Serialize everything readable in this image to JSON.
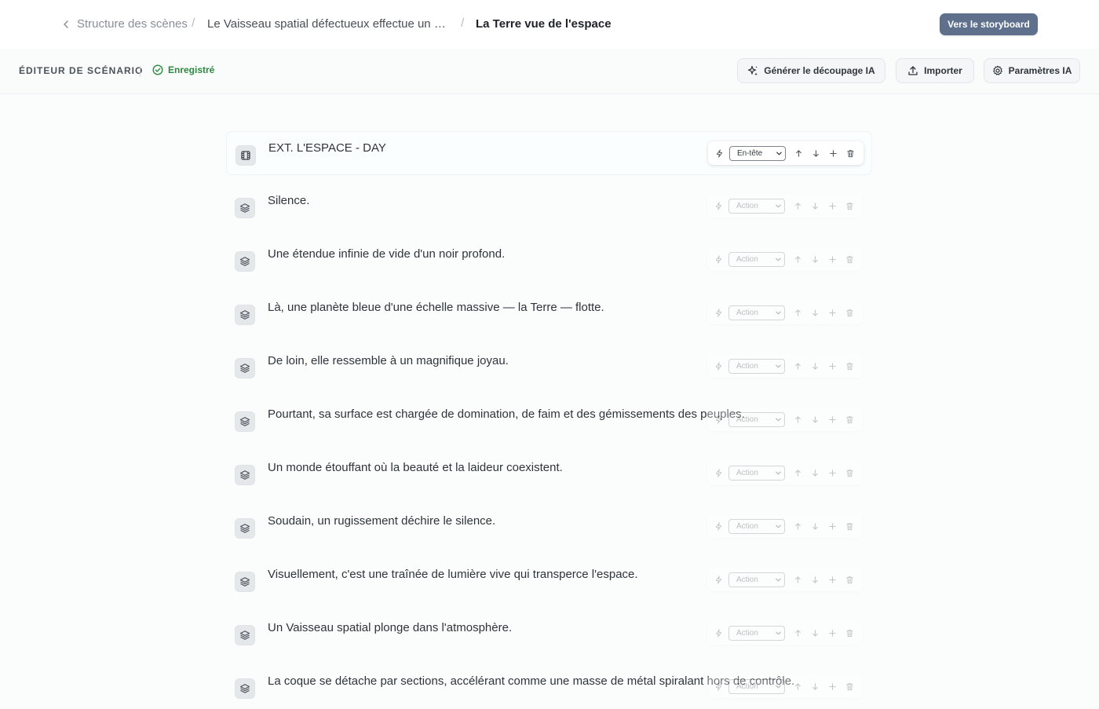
{
  "breadcrumb": {
    "back_label": "Structure des scènes",
    "middle": "Le Vaisseau spatial défectueux effectue un atte…",
    "current": "La Terre vue de l'espace"
  },
  "header": {
    "storyboard_button": "Vers le storyboard"
  },
  "toolbar": {
    "title": "ÉDITEUR DE SCÉNARIO",
    "saved_status": "Enregistré",
    "generate_button": "Générer le découpage IA",
    "import_button": "Importer",
    "settings_button": "Paramètres IA"
  },
  "colors": {
    "accent": "#5e708c",
    "saved": "#2b8a3e"
  },
  "lines": [
    {
      "icon": "film-icon",
      "text": "EXT. L'ESPACE - DAY",
      "type": "En-tête",
      "active": true
    },
    {
      "icon": "layers-icon",
      "text": "Silence.",
      "type": "Action",
      "active": false
    },
    {
      "icon": "layers-icon",
      "text": "Une étendue infinie de vide d'un noir profond.",
      "type": "Action",
      "active": false
    },
    {
      "icon": "layers-icon",
      "text": "Là, une planète bleue d'une échelle massive — la Terre — flotte.",
      "type": "Action",
      "active": false
    },
    {
      "icon": "layers-icon",
      "text": "De loin, elle ressemble à un magnifique joyau.",
      "type": "Action",
      "active": false
    },
    {
      "icon": "layers-icon",
      "text": "Pourtant, sa surface est chargée de domination, de faim et des gémissements des peuples.",
      "type": "Action",
      "active": false
    },
    {
      "icon": "layers-icon",
      "text": "Un monde étouffant où la beauté et la laideur coexistent.",
      "type": "Action",
      "active": false
    },
    {
      "icon": "layers-icon",
      "text": "Soudain, un rugissement déchire le silence.",
      "type": "Action",
      "active": false
    },
    {
      "icon": "layers-icon",
      "text": "Visuellement, c'est une traînée de lumière vive qui transperce l'espace.",
      "type": "Action",
      "active": false
    },
    {
      "icon": "layers-icon",
      "text": "Un Vaisseau spatial plonge dans l'atmosphère.",
      "type": "Action",
      "active": false
    },
    {
      "icon": "layers-icon",
      "text": "La coque se détache par sections, accélérant comme une masse de métal spiralant hors de contrôle.",
      "type": "Action",
      "active": false
    }
  ]
}
